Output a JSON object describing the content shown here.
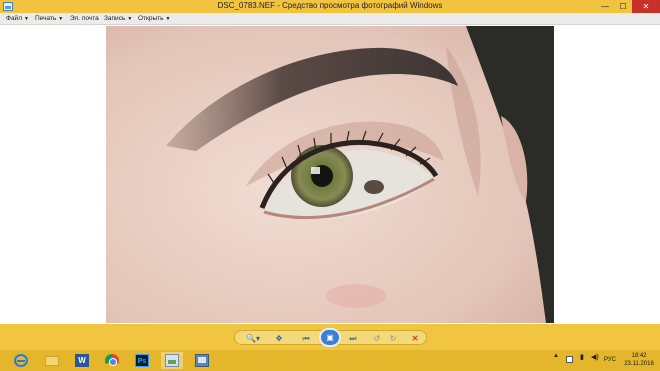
{
  "window": {
    "title": "DSC_0783.NEF - Средство просмотра фотографий Windows",
    "minimize": "—",
    "maximize": "☐",
    "close": "✕"
  },
  "menu": {
    "file": "Файл",
    "print": "Печать",
    "email": "Эл. почта",
    "burn": "Запись",
    "open": "Открыть",
    "caret": "▼"
  },
  "photo": {
    "icon": "photo"
  },
  "controls": {
    "zoom": "🔍▾",
    "fit": "✥",
    "prev": "⏮",
    "slideshow": "▣",
    "next": "⏭",
    "rotate_left": "↺",
    "rotate_right": "↻",
    "delete": "✕"
  },
  "taskbar": {
    "apps": [
      {
        "name": "internet-explorer-icon"
      },
      {
        "name": "file-explorer-icon"
      },
      {
        "name": "word-icon",
        "glyph": "W"
      },
      {
        "name": "chrome-icon"
      },
      {
        "name": "photoshop-icon",
        "glyph": "Ps"
      },
      {
        "name": "photo-viewer-icon"
      },
      {
        "name": "image-app-icon"
      }
    ],
    "tray": {
      "up_arrow": "▲",
      "network": "▮",
      "volume": "◀)",
      "language": "РУС"
    },
    "time": "18:42",
    "date": "23.11.2016"
  },
  "colors": {
    "titlebar": "#f2c33f",
    "close_button": "#c7312a",
    "controlbar": "#f0c640",
    "taskbar": "#e3b62c",
    "slideshow_button": "#3d7fd0"
  }
}
